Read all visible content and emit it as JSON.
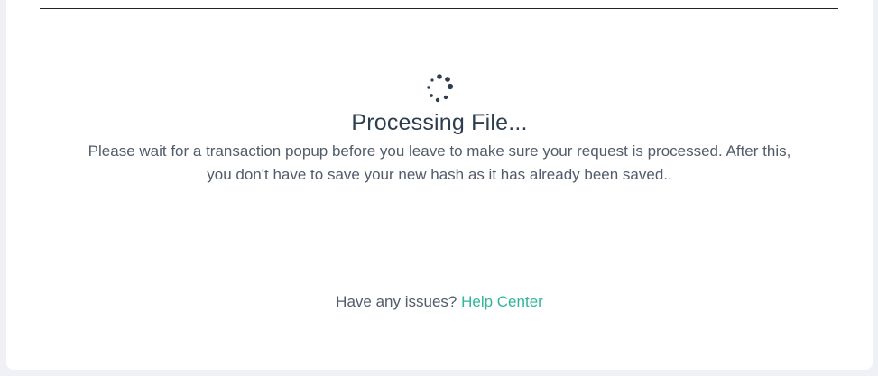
{
  "status": {
    "title": "Processing File...",
    "message": "Please wait for a transaction popup before you leave to make sure your request is processed. After this, you don't have to save your new hash as it has already been saved.."
  },
  "footer": {
    "question": "Have any issues?",
    "help_link": "Help Center"
  },
  "icons": {
    "spinner": "loading-spinner-icon"
  },
  "colors": {
    "title": "#2f3e4e",
    "text": "#525c6b",
    "link": "#2fb59a",
    "spinner": "#2f3e4e",
    "background": "#f0f1f7",
    "card": "#ffffff"
  }
}
